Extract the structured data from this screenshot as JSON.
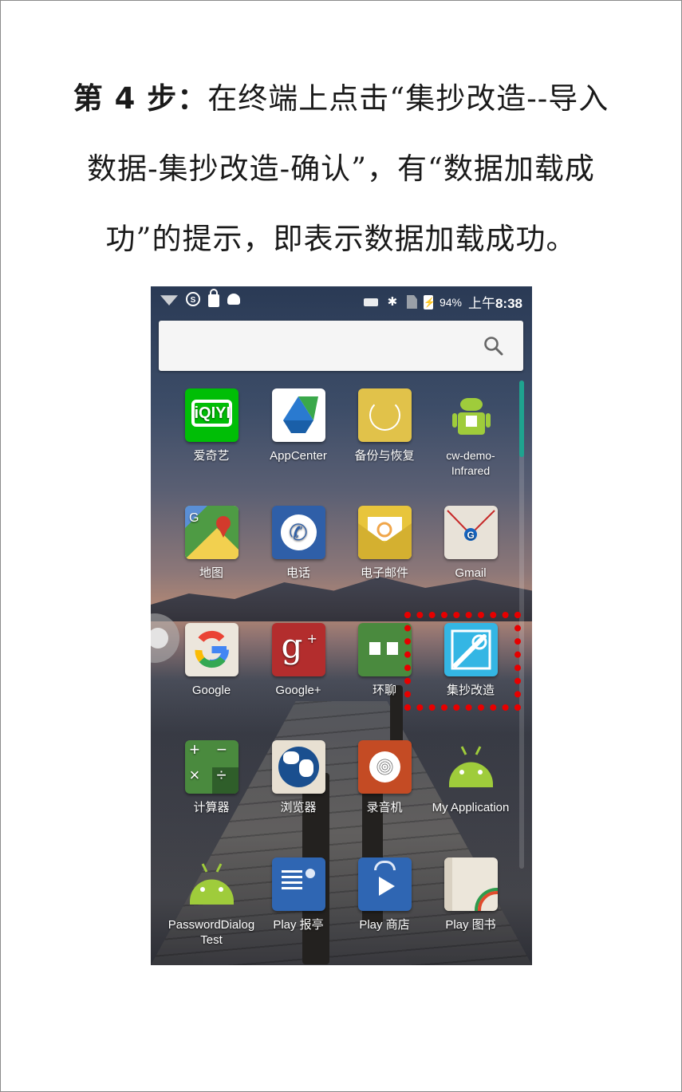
{
  "instructions": {
    "step_label": "第 4 步：",
    "line1_rest": "在终端上点击“集抄改造--导入",
    "line2": "数据-集抄改造-确认”，有“数据加载成",
    "line3": "功”的提示，即表示数据加载成功。"
  },
  "status_bar": {
    "battery_percent": "94%",
    "time_prefix": "上午",
    "time": "8:38",
    "left_icons": [
      "wifi-icon",
      "s-circle-icon",
      "lock-icon",
      "android-notif-icon"
    ],
    "right_icons": [
      "keyboard-icon",
      "bluetooth-icon",
      "no-sim-icon",
      "battery-charging-icon"
    ]
  },
  "search": {
    "icon": "search-icon"
  },
  "apps": [
    {
      "label": "爱奇艺",
      "icon": "iqiyi-icon"
    },
    {
      "label": "AppCenter",
      "icon": "appcenter-icon"
    },
    {
      "label": "备份与恢复",
      "icon": "backup-restore-icon"
    },
    {
      "label": "cw-demo-Infrared",
      "icon": "android-robot-icon"
    },
    {
      "label": "地图",
      "icon": "maps-icon"
    },
    {
      "label": "电话",
      "icon": "phone-icon"
    },
    {
      "label": "电子邮件",
      "icon": "email-icon"
    },
    {
      "label": "Gmail",
      "icon": "gmail-icon"
    },
    {
      "label": "Google",
      "icon": "google-icon"
    },
    {
      "label": "Google+",
      "icon": "google-plus-icon"
    },
    {
      "label": "环聊",
      "icon": "hangouts-icon"
    },
    {
      "label": "集抄改造",
      "icon": "meter-reading-icon"
    },
    {
      "label": "计算器",
      "icon": "calculator-icon"
    },
    {
      "label": "浏览器",
      "icon": "browser-globe-icon"
    },
    {
      "label": "录音机",
      "icon": "recorder-icon"
    },
    {
      "label": "My Application",
      "icon": "android-robot-icon"
    },
    {
      "label": "PasswordDialog Test",
      "icon": "android-robot-icon"
    },
    {
      "label": "Play 报亭",
      "icon": "play-newsstand-icon"
    },
    {
      "label": "Play 商店",
      "icon": "play-store-icon"
    },
    {
      "label": "Play 图书",
      "icon": "play-books-icon"
    }
  ],
  "highlight_target": "集抄改造",
  "colors": {
    "highlight": "#e60000",
    "scroll_thumb": "#1fa38f"
  }
}
